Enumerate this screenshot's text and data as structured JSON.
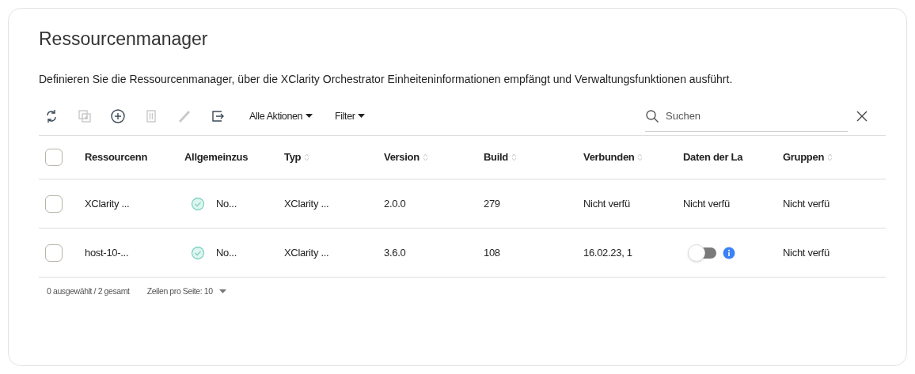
{
  "title": "Ressourcenmanager",
  "description": "Definieren Sie die Ressourcenmanager, über die XClarity Orchestrator Einheiteninformationen empfängt und Verwaltungsfunktionen ausführt.",
  "toolbar": {
    "tools": [
      {
        "kind": "refresh",
        "disabled": false
      },
      {
        "kind": "copy",
        "disabled": true
      },
      {
        "kind": "add",
        "disabled": false
      },
      {
        "kind": "delete",
        "disabled": true
      },
      {
        "kind": "edit",
        "disabled": true
      },
      {
        "kind": "export",
        "disabled": false
      }
    ],
    "menus": [
      "Alle Aktionen",
      "Filter"
    ],
    "search": {
      "placeholder": "Suchen"
    }
  },
  "table": {
    "select_all_checked": false,
    "columns": [
      {
        "label": "Ressourcenn",
        "sortable": false
      },
      {
        "label": "Allgemeinzus",
        "sortable": false
      },
      {
        "label": "Typ",
        "sortable": true
      },
      {
        "label": "Version",
        "sortable": true
      },
      {
        "label": "Build",
        "sortable": true
      },
      {
        "label": "Verbunden",
        "sortable": true
      },
      {
        "label": "Daten der La",
        "sortable": false
      },
      {
        "label": "Gruppen",
        "sortable": true
      }
    ],
    "rows": [
      {
        "checked": false,
        "cells": [
          {
            "kind": "text",
            "text": "XClarity ..."
          },
          {
            "kind": "status",
            "text": "No..."
          },
          {
            "kind": "text",
            "text": "XClarity ..."
          },
          {
            "kind": "text",
            "text": "2.0.0"
          },
          {
            "kind": "text",
            "text": "279"
          },
          {
            "kind": "text",
            "text": "Nicht verfü"
          },
          {
            "kind": "text",
            "text": "Nicht verfü"
          },
          {
            "kind": "text",
            "text": "Nicht verfü"
          }
        ]
      },
      {
        "checked": false,
        "cells": [
          {
            "kind": "text",
            "text": "host-10-..."
          },
          {
            "kind": "status",
            "text": "No..."
          },
          {
            "kind": "text",
            "text": "XClarity ..."
          },
          {
            "kind": "text",
            "text": "3.6.0"
          },
          {
            "kind": "text",
            "text": "108"
          },
          {
            "kind": "text",
            "text": "16.02.23, 1"
          },
          {
            "kind": "toggle",
            "on": false
          },
          {
            "kind": "text",
            "text": "Nicht verfü"
          }
        ]
      }
    ]
  },
  "footer": {
    "selection": "0 ausgewählt / 2 gesamt",
    "rows_per_page": "Zeilen pro Seite: 10"
  }
}
